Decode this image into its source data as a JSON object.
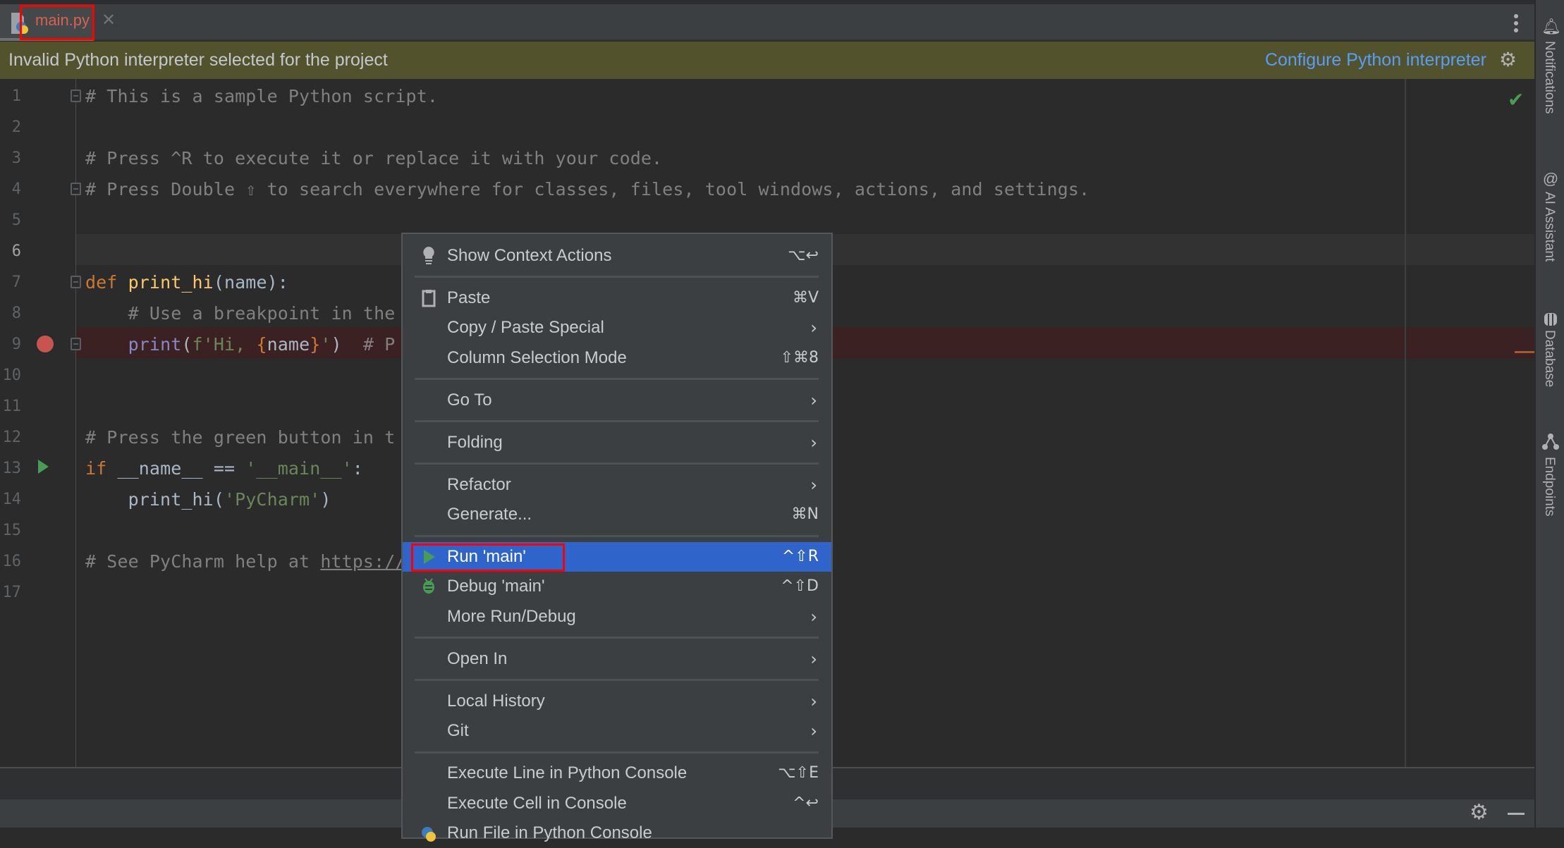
{
  "tab": {
    "label": "main.py",
    "close": "✕",
    "icon": "python-file-icon"
  },
  "banner": {
    "message": "Invalid Python interpreter selected for the project",
    "link": "Configure Python interpreter",
    "icon": "gear-icon"
  },
  "editor": {
    "current_line": 6,
    "breakpoint_line": 9,
    "run_gutter_line": 13,
    "line_numbers": [
      "1",
      "2",
      "3",
      "4",
      "5",
      "6",
      "7",
      "8",
      "9",
      "10",
      "11",
      "12",
      "13",
      "14",
      "15",
      "16",
      "17"
    ],
    "lines": {
      "l1": "# This is a sample Python script.",
      "l3": "# Press ^R to execute it or replace it with your code.",
      "l4": "# Press Double ⇧ to search everywhere for classes, files, tool windows, actions, and settings.",
      "l7": {
        "kw": "def",
        "fn": "print_hi",
        "rest": "(name):"
      },
      "l8": "    # Use a breakpoint in the",
      "l9": {
        "indent": "    ",
        "builtin": "print",
        "p1": "(",
        "str1": "f'Hi, ",
        "brace1": "{",
        "var": "name",
        "brace2": "}",
        "str2": "'",
        "p2": ")",
        "comment": "  # P"
      },
      "l12": "# Press the green button in t",
      "l13": {
        "kw": "if",
        "mid": " __name__ == ",
        "str": "'__main__'",
        "end": ":"
      },
      "l14": {
        "fn": "    print_hi(",
        "str": "'PyCharm'",
        "end": ")"
      },
      "l16": {
        "comment": "# See PyCharm help at ",
        "link": "https://"
      }
    }
  },
  "right_sidebar": [
    {
      "label": "Notifications",
      "icon": "bell-icon"
    },
    {
      "label": "AI Assistant",
      "icon": "ai-assistant-icon"
    },
    {
      "label": "Database",
      "icon": "database-icon"
    },
    {
      "label": "Endpoints",
      "icon": "endpoints-icon"
    }
  ],
  "context_menu": {
    "items": [
      {
        "label": "Show Context Actions",
        "shortcut": "⌥↩",
        "icon": "bulb-icon"
      },
      {
        "label": "Paste",
        "shortcut": "⌘V",
        "icon": "clipboard-icon"
      },
      {
        "label": "Copy / Paste Special",
        "submenu": true
      },
      {
        "label": "Column Selection Mode",
        "shortcut": "⇧⌘8"
      },
      {
        "label": "Go To",
        "submenu": true
      },
      {
        "label": "Folding",
        "submenu": true
      },
      {
        "label": "Refactor",
        "submenu": true
      },
      {
        "label": "Generate...",
        "shortcut": "⌘N"
      },
      {
        "label": "Run 'main'",
        "shortcut": "^⇧R",
        "icon": "run-icon",
        "selected": true
      },
      {
        "label": "Debug 'main'",
        "shortcut": "^⇧D",
        "icon": "debug-icon"
      },
      {
        "label": "More Run/Debug",
        "submenu": true
      },
      {
        "label": "Open In",
        "submenu": true
      },
      {
        "label": "Local History",
        "submenu": true
      },
      {
        "label": "Git",
        "submenu": true
      },
      {
        "label": "Execute Line in Python Console",
        "shortcut": "⌥⇧E"
      },
      {
        "label": "Execute Cell in Console",
        "shortcut": "^↩"
      },
      {
        "label": "Run File in Python Console",
        "icon": "python-icon"
      }
    ],
    "submenu_arrow": "›"
  },
  "colors": {
    "accent": "#2f65ca",
    "banner_bg": "#52532d",
    "link": "#589df6",
    "annotation_box": "#ff0000",
    "breakpoint": "#c75450",
    "run": "#499c54"
  }
}
